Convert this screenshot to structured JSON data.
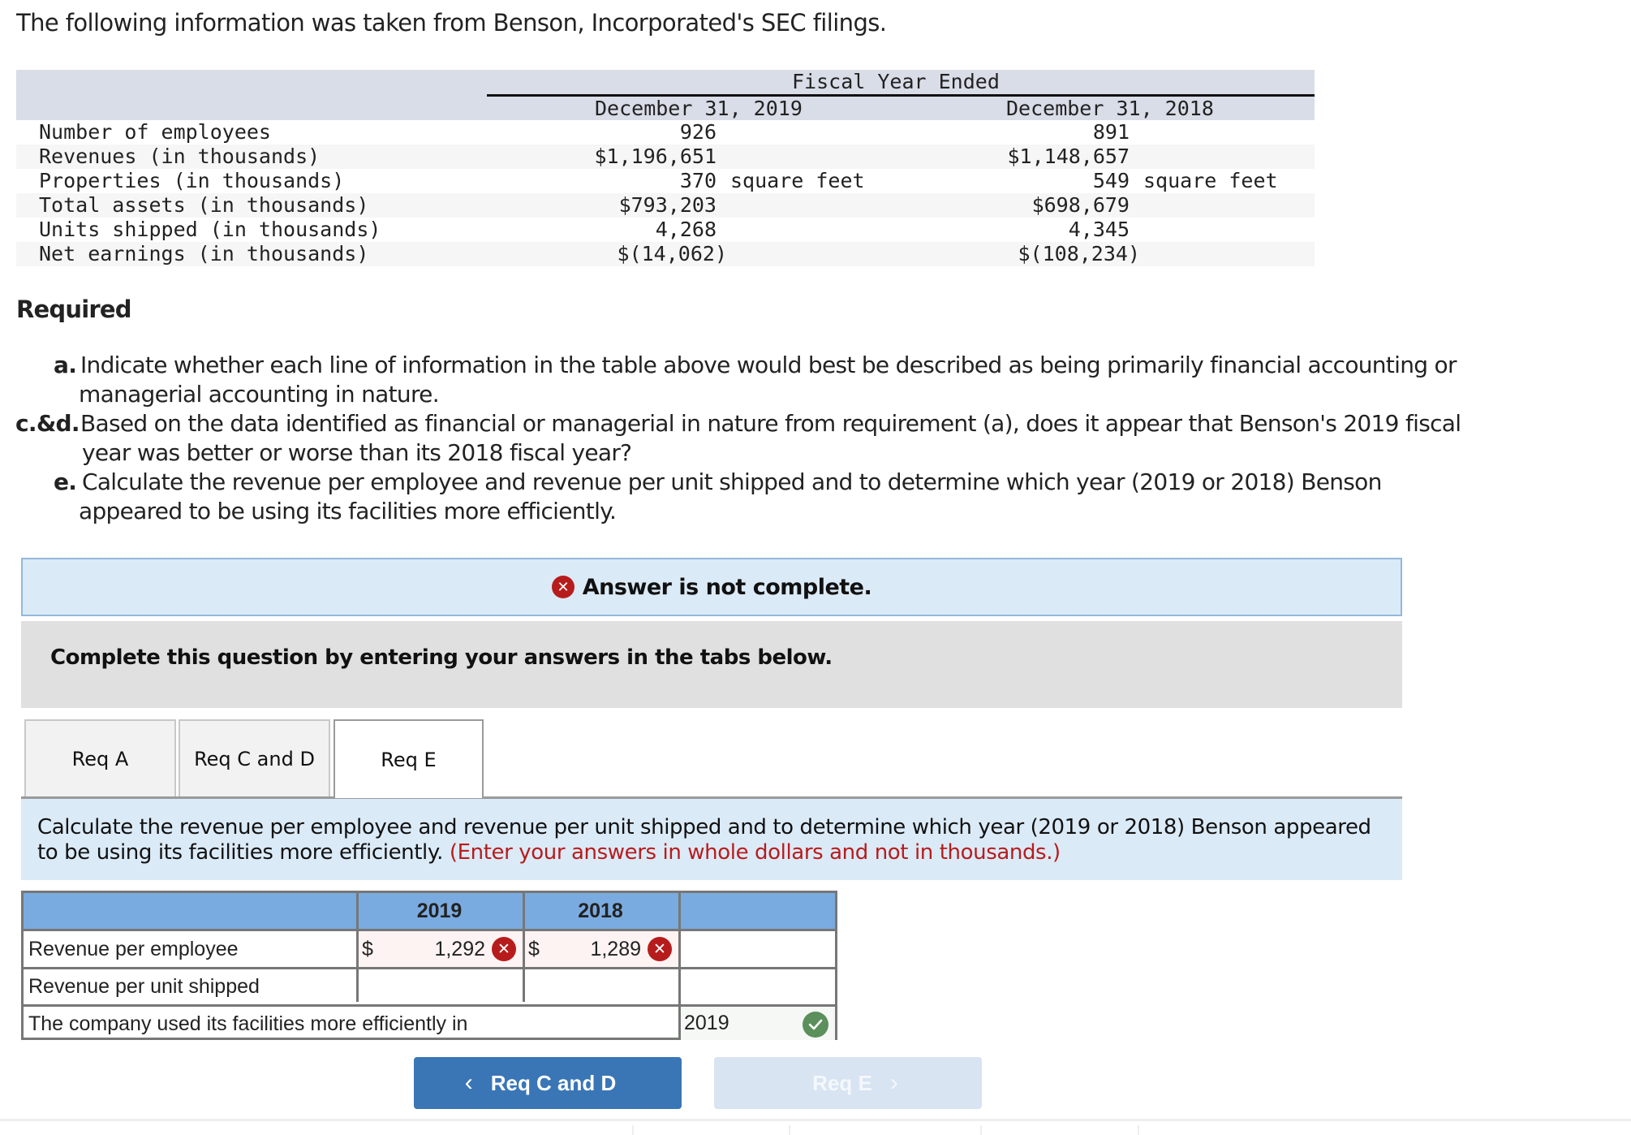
{
  "intro": "The following information was taken from Benson, Incorporated's SEC filings.",
  "info_table": {
    "group_header": "Fiscal Year Ended",
    "columns": [
      "December 31, 2019",
      "December 31, 2018"
    ],
    "rows": [
      {
        "label": "Number of employees",
        "v2019": "926",
        "v2018": "891",
        "unit": ""
      },
      {
        "label": "Revenues (in thousands)",
        "v2019": "$1,196,651",
        "v2018": "$1,148,657",
        "unit": ""
      },
      {
        "label": "Properties (in thousands)",
        "v2019": "370",
        "v2018": "549",
        "unit": "square feet"
      },
      {
        "label": "Total assets (in thousands)",
        "v2019": "$793,203",
        "v2018": "$698,679",
        "unit": ""
      },
      {
        "label": "Units shipped (in thousands)",
        "v2019": "4,268",
        "v2018": "4,345",
        "unit": ""
      },
      {
        "label": "Net earnings (in thousands)",
        "v2019": "$(14,062)",
        "v2018": "$(108,234)",
        "unit": ""
      }
    ]
  },
  "required": {
    "heading": "Required",
    "items": [
      {
        "label": "a.",
        "line1": "Indicate whether each line of information in the table above would best be described as being primarily financial accounting or",
        "line2": "managerial accounting in nature."
      },
      {
        "label": "c.&d.",
        "line1": "Based on the data identified as financial or managerial in nature from requirement (a), does it appear that Benson's 2019 fiscal",
        "line2": "year was better or worse than its 2018 fiscal year?"
      },
      {
        "label": "e.",
        "line1": "Calculate the revenue per employee and revenue per unit shipped and to determine which year (2019 or 2018) Benson",
        "line2": "appeared to be using its facilities more efficiently."
      }
    ]
  },
  "status": {
    "message": "Answer is not complete.",
    "icon": "x-circle-icon",
    "color": "#b71c1c"
  },
  "instructions_banner": "Complete this question by entering your answers in the tabs below.",
  "tabs": [
    {
      "label": "Req A",
      "active": false
    },
    {
      "label": "Req C and D",
      "active": false
    },
    {
      "label": "Req E",
      "active": true
    }
  ],
  "tab_content": {
    "instruction": "Calculate the revenue per employee and revenue per unit shipped and to determine which year (2019 or 2018) Benson appeared to be using its facilities more efficiently.",
    "note": "(Enter your answers in whole dollars and not in thousands.)"
  },
  "answer_table": {
    "headers": [
      "",
      "2019",
      "2018",
      ""
    ],
    "rows": [
      {
        "label": "Revenue per employee",
        "currency": "$",
        "v2019": "1,292",
        "v2019_status": "incorrect",
        "v2018": "1,289",
        "v2018_status": "incorrect"
      },
      {
        "label": "Revenue per unit shipped",
        "currency": "",
        "v2019": "",
        "v2018": ""
      },
      {
        "label": "The company used its facilities more efficiently in",
        "answer": "2019",
        "answer_status": "correct"
      }
    ]
  },
  "nav": {
    "prev_label": "Req C and D",
    "next_label": "Req E",
    "prev_chevron": "‹",
    "next_chevron": "›"
  },
  "colors": {
    "header_bg": "#7aabe0",
    "incorrect": "#b71c1c",
    "correct": "#5b8f5b",
    "prev_button": "#3a76b6",
    "next_button_disabled": "#d8e4f1"
  }
}
